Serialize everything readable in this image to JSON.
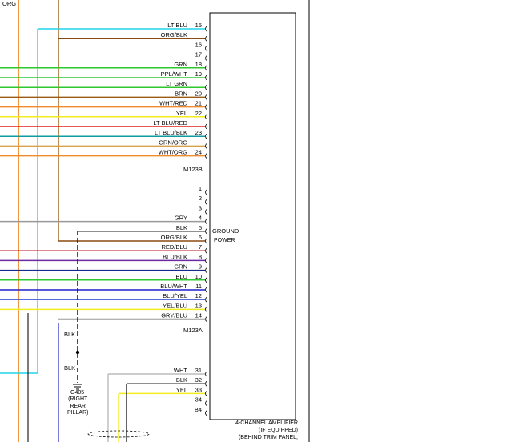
{
  "top_left_label": "ORG",
  "connector_top": {
    "name": "M123B",
    "pins": [
      {
        "pin": "15",
        "label": "LT BLU",
        "color": "#22d4e8"
      },
      {
        "pin": "",
        "label": "ORG/BLK",
        "color": "#8b4a12"
      },
      {
        "pin": "16",
        "label": "",
        "color": ""
      },
      {
        "pin": "17",
        "label": "",
        "color": ""
      },
      {
        "pin": "18",
        "label": "GRN",
        "color": "#2ec82e"
      },
      {
        "pin": "19",
        "label": "PPL/WHT",
        "color": "#2ec82e"
      },
      {
        "pin": "",
        "label": "LT GRN",
        "color": "#2ec82e"
      },
      {
        "pin": "20",
        "label": "BRN",
        "color": "#9a5a12"
      },
      {
        "pin": "21",
        "label": "WHT/RED",
        "color": "#f08a2a"
      },
      {
        "pin": "22",
        "label": "YEL",
        "color": "#f2ec1e"
      },
      {
        "pin": "",
        "label": "LT BLU/RED",
        "color": "#e02020"
      },
      {
        "pin": "23",
        "label": "LT BLU/BLK",
        "color": "#119aa0"
      },
      {
        "pin": "",
        "label": "GRN/ORG",
        "color": "#d9a04a"
      },
      {
        "pin": "24",
        "label": "WHT/ORG",
        "color": "#f08a2a"
      }
    ]
  },
  "connector_mid": {
    "name": "M123A",
    "pins": [
      {
        "pin": "1",
        "label": "",
        "color": ""
      },
      {
        "pin": "2",
        "label": "",
        "color": ""
      },
      {
        "pin": "3",
        "label": "",
        "color": ""
      },
      {
        "pin": "4",
        "label": "GRY",
        "color": "#999999"
      },
      {
        "pin": "5",
        "label": "BLK",
        "color": "#222222"
      },
      {
        "pin": "6",
        "label": "ORG/BLK",
        "color": "#8b4a12"
      },
      {
        "pin": "7",
        "label": "RED/BLU",
        "color": "#c01020"
      },
      {
        "pin": "8",
        "label": "BLU/BLK",
        "color": "#6a2aa0"
      },
      {
        "pin": "9",
        "label": "GRN",
        "color": "#1a2a8a"
      },
      {
        "pin": "10",
        "label": "BLU",
        "color": "#2ec82e"
      },
      {
        "pin": "11",
        "label": "BLU/WHT",
        "color": "#2020c8"
      },
      {
        "pin": "12",
        "label": "BLU/YEL",
        "color": "#5a6ad8"
      },
      {
        "pin": "13",
        "label": "YEL/BLU",
        "color": "#f2ec1e"
      },
      {
        "pin": "14",
        "label": "GRY/BLU",
        "color": "#333333"
      }
    ],
    "ground_label": "GROUND",
    "power_label": "POWER"
  },
  "connector_bottom": {
    "pins": [
      {
        "pin": "31",
        "label": "WHT",
        "color": "#bbbbbb"
      },
      {
        "pin": "32",
        "label": "BLK",
        "color": "#222222"
      },
      {
        "pin": "33",
        "label": "YEL",
        "color": "#f2ec1e"
      },
      {
        "pin": "34",
        "label": "",
        "color": ""
      },
      {
        "pin": "B4",
        "label": "",
        "color": ""
      }
    ]
  },
  "ground_wire": {
    "label_top": "BLK",
    "label_bottom": "BLK",
    "ground_id": "G405",
    "ground_desc": [
      "(RIGHT",
      "REAR",
      "PILLAR)"
    ]
  },
  "amplifier": {
    "lines": [
      "4-CHANNEL AMPLIFIER",
      "(IF EQUIPPED)",
      "(BEHIND TRIM PANEL,"
    ]
  }
}
